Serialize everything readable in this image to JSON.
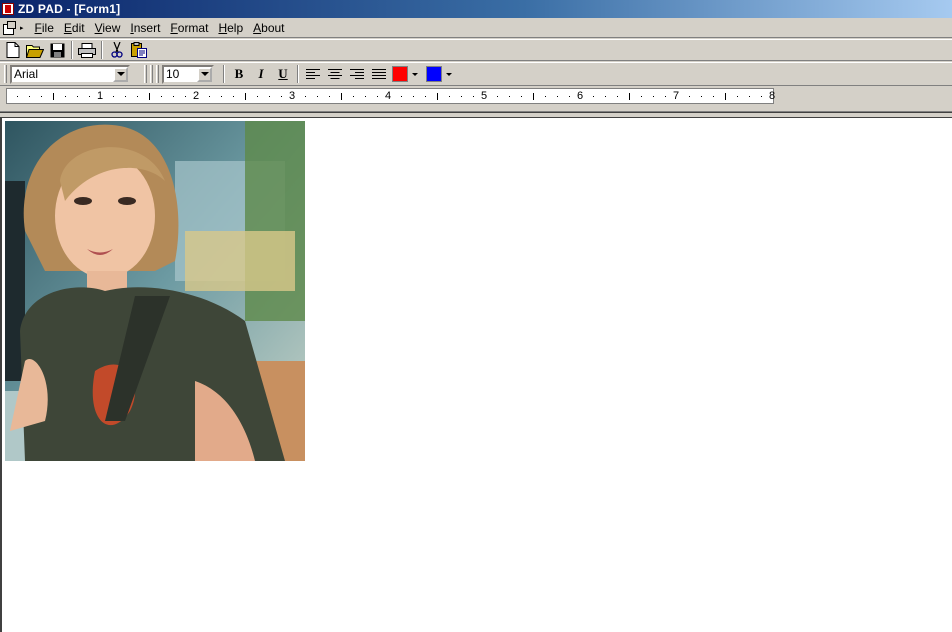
{
  "window": {
    "title": "ZD PAD - [Form1]"
  },
  "menu": {
    "items": [
      {
        "label": "File"
      },
      {
        "label": "Edit"
      },
      {
        "label": "View"
      },
      {
        "label": "Insert"
      },
      {
        "label": "Format"
      },
      {
        "label": "Help"
      },
      {
        "label": "About"
      }
    ]
  },
  "format_bar": {
    "font_name": "Arial",
    "font_size": "10",
    "bold_label": "B",
    "italic_label": "I",
    "underline_label": "U",
    "font_color": "#ff0000",
    "highlight_color": "#0000ff"
  },
  "ruler": {
    "numbers": [
      "1",
      "2",
      "3",
      "4",
      "5",
      "6",
      "7",
      "8"
    ]
  },
  "colors": {
    "titlebar_start": "#0a246a",
    "face": "#d4d0c8"
  }
}
